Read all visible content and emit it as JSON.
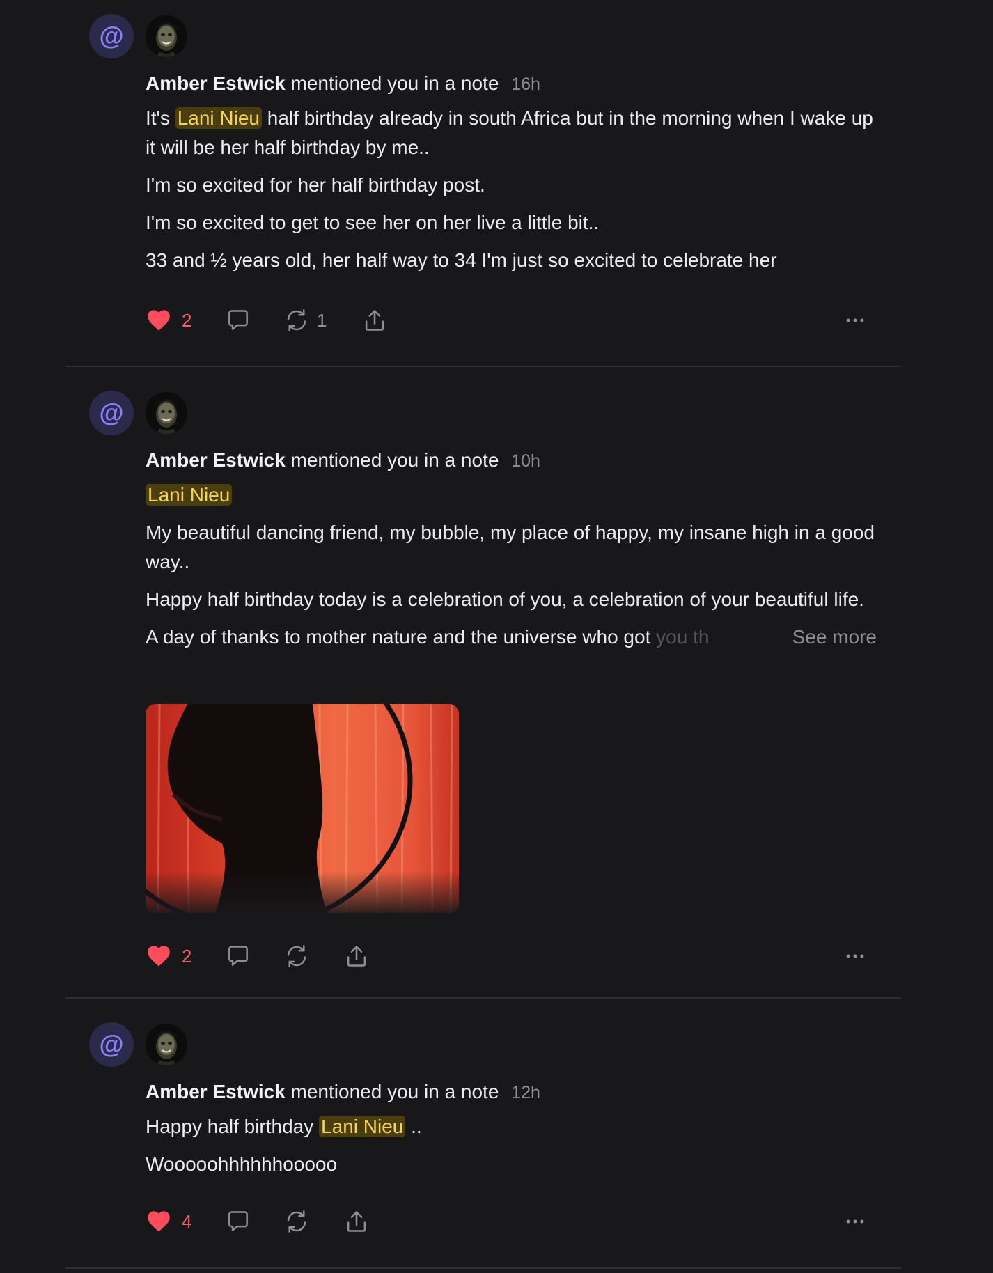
{
  "notifications": [
    {
      "badge": "@",
      "author": "Amber Estwick",
      "action": "mentioned you in a note",
      "time": "16h",
      "line1_pre": "It's",
      "mention": "Lani Nieu",
      "line1_post": "half birthday already in south Africa but in the morning when I wake up it will be her half birthday by me..",
      "para2": "I'm so excited for her half birthday post.",
      "para3": "I'm so excited to get to see her on her live a little bit..",
      "para4": "33 and ½ years old, her half way to 34 I'm just so excited to celebrate her",
      "likes": "2",
      "restacks": "1"
    },
    {
      "badge": "@",
      "author": "Amber Estwick",
      "action": "mentioned you in a note",
      "time": "10h",
      "mention": "Lani Nieu",
      "para1": "My beautiful dancing friend, my bubble, my place of happy, my insane high in a good way..",
      "para2": "Happy half birthday today is a celebration of you, a celebration of your beautiful life.",
      "para3_visible": "A day of thanks to mother nature and the universe who got",
      "para3_faded": "you th",
      "see_more": "See more",
      "likes": "2"
    },
    {
      "badge": "@",
      "author": "Amber Estwick",
      "action": "mentioned you in a note",
      "time": "12h",
      "line1_pre": "Happy half birthday",
      "mention": "Lani Nieu",
      "line1_post": "..",
      "para2": "Wooooohhhhhhooooo",
      "likes": "4"
    }
  ],
  "colors": {
    "background": "#18181b",
    "like": "#ff4d5e",
    "mention_highlight_bg": "#4a3d0e",
    "mention_highlight_text": "#f7d64a",
    "badge_bg": "#2c2a4a",
    "badge_fg": "#8b7dff"
  },
  "icons": [
    "at-icon",
    "heart-icon",
    "comment-icon",
    "restack-icon",
    "share-icon",
    "more-icon"
  ]
}
